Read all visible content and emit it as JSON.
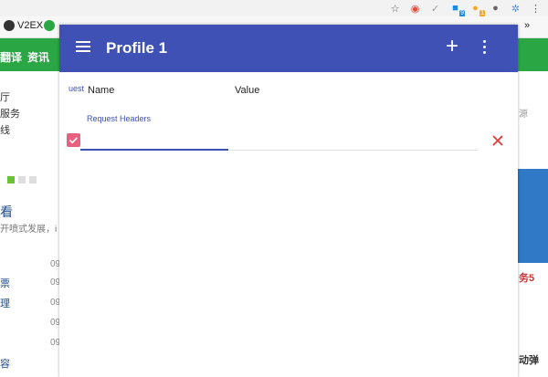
{
  "browser": {
    "extension_icons": [
      {
        "name": "star-icon",
        "glyph": "☆",
        "color": "#555",
        "badge": ""
      },
      {
        "name": "extension-icon-1",
        "glyph": "◉",
        "color": "#e74c3c",
        "badge": ""
      },
      {
        "name": "check-icon",
        "glyph": "✓",
        "color": "#999",
        "badge": ""
      },
      {
        "name": "extension-icon-2",
        "glyph": "■",
        "color": "#1e88e5",
        "badge": "9"
      },
      {
        "name": "extension-icon-3",
        "glyph": "●",
        "color": "#f5a623",
        "badge": "1"
      },
      {
        "name": "extension-icon-4",
        "glyph": "●",
        "color": "#666",
        "badge": ""
      },
      {
        "name": "extension-active-icon",
        "glyph": "✲",
        "color": "#5b8dd6",
        "badge": ""
      },
      {
        "name": "kebab-menu-icon",
        "glyph": "⋮",
        "color": "#555",
        "badge": ""
      }
    ],
    "bookmarks": [
      "V2EX"
    ],
    "bookmarks_overflow": "»"
  },
  "background_page": {
    "nav_items": [
      "翻译",
      "资讯"
    ],
    "left_snippets": [
      "厅",
      "服务",
      "线",
      "看",
      "开喷式发展，i",
      "票",
      "理",
      "容"
    ],
    "side_numbers": [
      "09",
      "09",
      "09",
      "09",
      "09"
    ],
    "right_snippets": [
      "源",
      "务5",
      "动弹"
    ]
  },
  "popup": {
    "title": "Profile 1",
    "tab_peek": "uest",
    "columns": {
      "name": "Name",
      "value": "Value"
    },
    "section_label": "Request Headers",
    "row": {
      "enabled": true,
      "name_value": "",
      "value_value": ""
    },
    "colors": {
      "appbar": "#3f51b5",
      "accent": "#3f51b5",
      "checkbox": "#e8607d",
      "delete": "#e53935"
    }
  }
}
